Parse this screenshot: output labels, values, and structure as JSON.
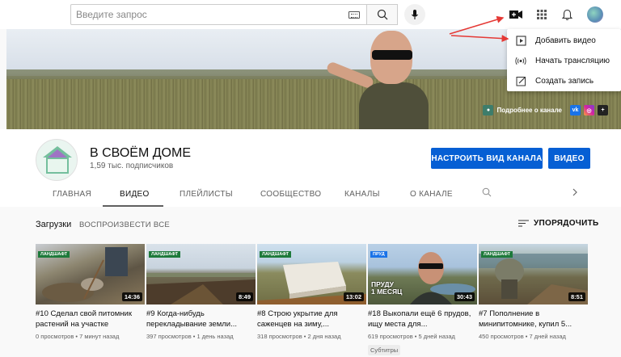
{
  "topbar": {
    "search_placeholder": "Введите запрос",
    "icons": [
      "keyboard-icon",
      "search-icon",
      "mic-icon",
      "create-video-icon",
      "apps-grid-icon",
      "bell-icon",
      "avatar"
    ]
  },
  "create_menu": {
    "items": [
      {
        "label": "Добавить видео",
        "icon": "upload-video-icon"
      },
      {
        "label": "Начать трансляцию",
        "icon": "live-broadcast-icon"
      },
      {
        "label": "Создать запись",
        "icon": "edit-post-icon"
      }
    ]
  },
  "banner": {
    "link_label": "Подробнее о канале",
    "social": [
      "vk-icon",
      "instagram-icon",
      "plus-icon"
    ]
  },
  "channel": {
    "name": "В СВОЁМ ДОМЕ",
    "subscribers": "1,59 тыс. подписчиков",
    "avatar_text": "В СВОЁМ ДОМЕ",
    "customize_button": "НАСТРОИТЬ ВИД КАНАЛА",
    "video_button": "ВИДЕО"
  },
  "tabs": [
    "ГЛАВНАЯ",
    "ВИДЕО",
    "ПЛЕЙЛИСТЫ",
    "СООБЩЕСТВО",
    "КАНАЛЫ",
    "О КАНАЛЕ"
  ],
  "active_tab": "ВИДЕО",
  "uploads": {
    "title": "Загрузки",
    "play_all": "ВОСПРОИЗВЕСТИ ВСЕ",
    "sort": "УПОРЯДОЧИТЬ"
  },
  "videos": [
    {
      "badge": "ЛАНДШАФТ",
      "duration": "14:36",
      "title": "#10 Сделал свой питомник растений на участке",
      "meta": "0 просмотров • 7 минут назад",
      "overlay": ""
    },
    {
      "badge": "ЛАНДШАФТ",
      "duration": "8:49",
      "title": "#9 Когда-нибудь перекладывание земли...",
      "meta": "397 просмотров • 1 день назад",
      "overlay": ""
    },
    {
      "badge": "ЛАНДШАФТ",
      "duration": "13:02",
      "title": "#8 Строю укрытие для саженцев на зиму,...",
      "meta": "318 просмотров • 2 дня назад",
      "overlay": ""
    },
    {
      "badge": "ПРУД",
      "duration": "30:43",
      "title": "#18 Выкопали ещё 6 прудов, ищу места для...",
      "meta": "619 просмотров • 5 дней назад",
      "overlay": "ПРУДУ\n1 МЕСЯЦ",
      "extra_badge": "Субтитры"
    },
    {
      "badge": "ЛАНДШАФТ",
      "duration": "8:51",
      "title": "#7 Пополнение в минипитомнике, купил 5...",
      "meta": "450 просмотров • 7 дней назад",
      "overlay": ""
    }
  ],
  "colors": {
    "accent": "#065fd4",
    "progress": "#ff0000",
    "badge_green": "#1e7a3b",
    "badge_blue": "#1a73e8",
    "arrow_red": "#e53935"
  }
}
